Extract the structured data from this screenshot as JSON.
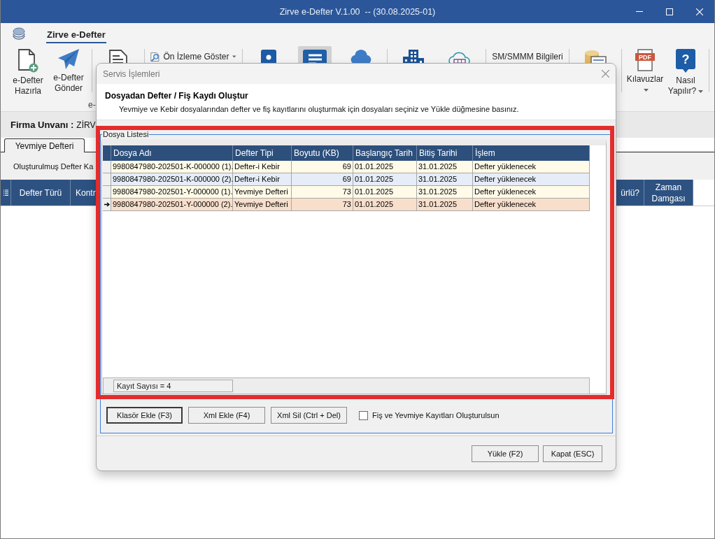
{
  "window": {
    "title": "Zirve e-Defter V.1.00  -- (30.08.2025-01)"
  },
  "ribbon": {
    "tabs": [
      {
        "label": "Zirve e-Defter",
        "selected": true
      }
    ],
    "groups": [
      {
        "items": [
          {
            "kind": "large",
            "label": "e-Defter Hazırla",
            "dropdown": false,
            "selected": false
          },
          {
            "kind": "large",
            "label": "e-Defter Gönder",
            "dropdown": false,
            "selected": false
          }
        ]
      },
      {
        "items": [
          {
            "kind": "icon",
            "selected": false
          }
        ]
      },
      {
        "items": [
          {
            "kind": "small",
            "label": "Ön İzleme Göster",
            "dropdown": true,
            "selected": false
          }
        ]
      },
      {
        "items": [
          {
            "kind": "icon",
            "selected": false
          },
          {
            "kind": "icon",
            "selected": true
          },
          {
            "kind": "icon",
            "selected": false
          }
        ]
      },
      {
        "items": [
          {
            "kind": "icon",
            "selected": false
          },
          {
            "kind": "icon",
            "selected": false
          }
        ]
      },
      {
        "items": [
          {
            "kind": "text",
            "label": "SM/SMMM Bilgileri",
            "dropdown": false,
            "selected": false
          }
        ]
      },
      {
        "items": [
          {
            "kind": "icon",
            "selected": false
          }
        ]
      },
      {
        "items": [
          {
            "kind": "large",
            "label": "Kılavuzlar",
            "icon_label": "PDF",
            "dropdown": true,
            "selected": false
          },
          {
            "kind": "large",
            "label": "Nasıl Yapılır?",
            "icon_label": "?",
            "dropdown": true,
            "selected": false
          }
        ]
      }
    ],
    "caption": "e-"
  },
  "company": {
    "label": "Firma Unvanı :",
    "value": "ZİRV"
  },
  "doc_tabs": [
    {
      "label": "Yevmiye Defteri",
      "selected": true
    }
  ],
  "section_title": "Oluşturulmuş Defter Ka",
  "main_table": {
    "columns": [
      "Defter Türü",
      "Kontr",
      "ürlü?",
      "Zaman Damgası"
    ]
  },
  "dialog": {
    "title": "Servis İşlemleri",
    "heading": "Dosyadan Defter / Fiş Kaydı Oluştur",
    "description": "Yevmiye ve Kebir dosyalarından defter ve fiş kayıtlarını oluşturmak için dosyaları seçiniz ve Yükle düğmesine basınız.",
    "group_title": "Dosya Listesi",
    "grid": {
      "columns": [
        "Dosya Adı",
        "Defter Tipi",
        "Boyutu (KB)",
        "Başlangıç Tarih",
        "Bitiş Tarihi",
        "İşlem"
      ],
      "rows": [
        {
          "selected": false,
          "cells": [
            "9980847980-202501-K-000000 (1).",
            "Defter-i Kebir",
            "69",
            "01.01.2025",
            "31.01.2025",
            "Defter yüklenecek"
          ]
        },
        {
          "selected": false,
          "cells": [
            "9980847980-202501-K-000000 (2).",
            "Defter-i Kebir",
            "69",
            "01.01.2025",
            "31.01.2025",
            "Defter yüklenecek"
          ]
        },
        {
          "selected": false,
          "cells": [
            "9980847980-202501-Y-000000 (1).",
            "Yevmiye Defteri",
            "73",
            "01.01.2025",
            "31.01.2025",
            "Defter yüklenecek"
          ]
        },
        {
          "selected": true,
          "cells": [
            "9980847980-202501-Y-000000 (2).",
            "Yevmiye Defteri",
            "73",
            "01.01.2025",
            "31.01.2025",
            "Defter yüklenecek"
          ]
        }
      ],
      "record_count": "Kayıt Sayısı = 4"
    },
    "buttons": [
      {
        "label": "Klasör Ekle (F3)",
        "focused": true
      },
      {
        "label": "Xml Ekle (F4)",
        "focused": false
      },
      {
        "label": "Xml Sil (Ctrl + Del)",
        "focused": false
      }
    ],
    "checkbox": {
      "label": "Fiş ve Yevmiye Kayıtları Oluşturulsun",
      "checked": false
    },
    "footer_buttons": [
      "Yükle (F2)",
      "Kapat (ESC)"
    ]
  }
}
